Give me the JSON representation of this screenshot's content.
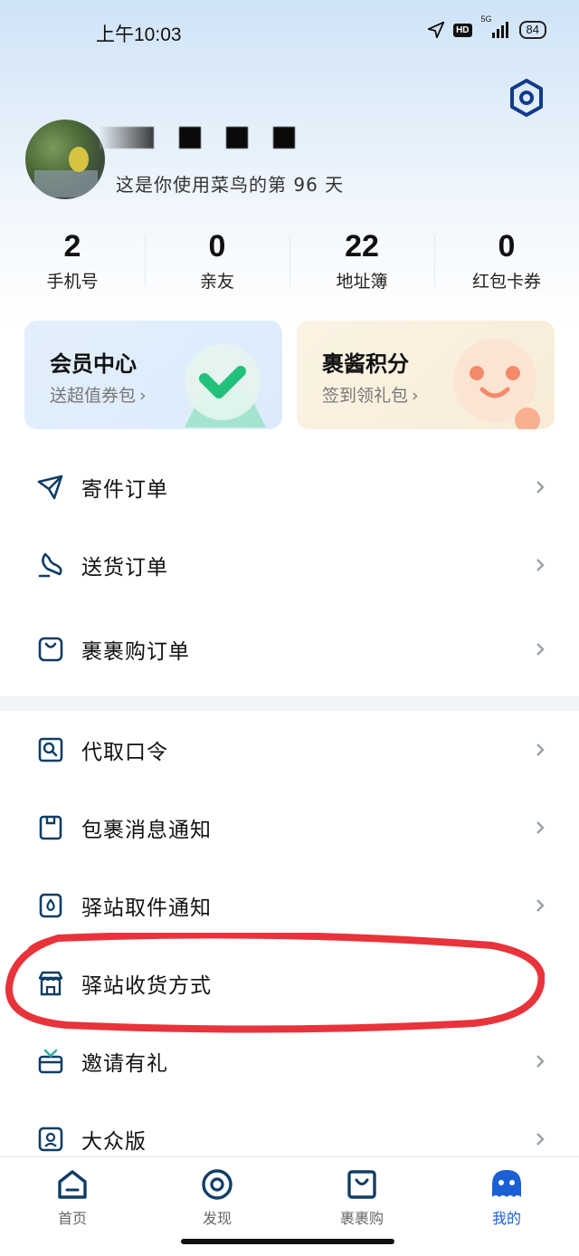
{
  "status_bar": {
    "time": "上午10:03",
    "hd": "HD",
    "network": "5G",
    "battery": "84"
  },
  "profile": {
    "usage_text": "这是你使用菜鸟的第 96 天"
  },
  "stats": [
    {
      "value": "2",
      "label": "手机号"
    },
    {
      "value": "0",
      "label": "亲友"
    },
    {
      "value": "22",
      "label": "地址簿"
    },
    {
      "value": "0",
      "label": "红包卡券"
    }
  ],
  "promos": {
    "member": {
      "title": "会员中心",
      "subtitle": "送超值券包"
    },
    "points": {
      "title": "裹酱积分",
      "subtitle": "签到领礼包"
    }
  },
  "menu_group_1": [
    {
      "label": "寄件订单",
      "icon": "send-icon"
    },
    {
      "label": "送货订单",
      "icon": "delivery-icon"
    },
    {
      "label": "裹裹购订单",
      "icon": "shopping-bag-icon"
    }
  ],
  "menu_group_2": [
    {
      "label": "代取口令",
      "icon": "pickup-code-icon"
    },
    {
      "label": "包裹消息通知",
      "icon": "package-notice-icon"
    },
    {
      "label": "驿站取件通知",
      "icon": "station-notice-icon"
    },
    {
      "label": "驿站收货方式",
      "icon": "storefront-icon"
    },
    {
      "label": "邀请有礼",
      "icon": "gift-icon"
    },
    {
      "label": "大众版",
      "icon": "standard-version-icon"
    }
  ],
  "tabs": [
    {
      "label": "首页",
      "icon": "home-icon"
    },
    {
      "label": "发现",
      "icon": "discover-icon"
    },
    {
      "label": "裹裹购",
      "icon": "shop-icon"
    },
    {
      "label": "我的",
      "icon": "profile-icon",
      "active": true
    }
  ],
  "colors": {
    "accent": "#1a5fd6",
    "icon_navy": "#0f3d66",
    "highlight_red": "#e8333a"
  }
}
